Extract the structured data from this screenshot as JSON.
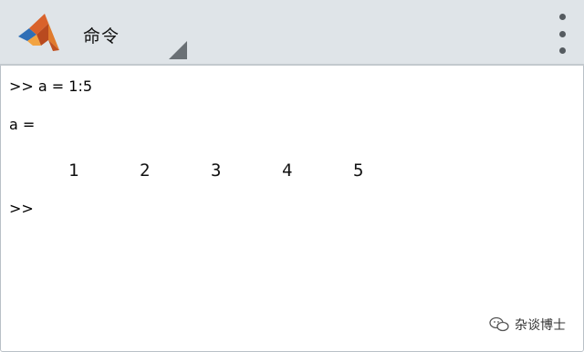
{
  "toolbar": {
    "title": "命令",
    "logo_icon": "matlab-logo-icon",
    "dropdown_icon": "corner-triangle-icon",
    "menu_icon": "overflow-menu-icon"
  },
  "console": {
    "line1": ">> a = 1:5",
    "line2": "a =",
    "values": [
      "1",
      "2",
      "3",
      "4",
      "5"
    ],
    "prompt": ">>"
  },
  "watermark": {
    "text": "杂谈博士",
    "icon": "wechat-icon"
  },
  "colors": {
    "toolbar_bg": "#dfe4e8",
    "background": "#ffffff",
    "menu_dots": "#555b60"
  }
}
